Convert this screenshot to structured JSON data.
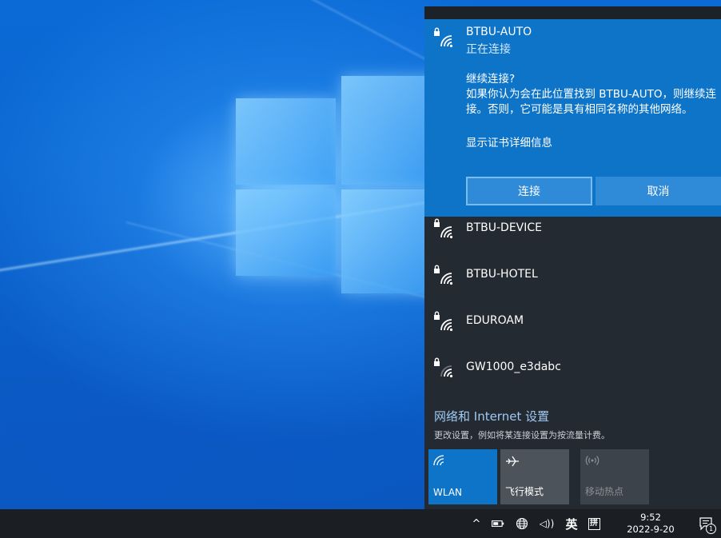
{
  "colors": {
    "accent": "#0d74c8",
    "flyout_bg": "#242a31",
    "taskbar_bg": "#1b1f24",
    "link": "#9fcaf3"
  },
  "flyout": {
    "selected": {
      "icon": "wifi-secured-icon",
      "name": "BTBU-AUTO",
      "status": "正在连接",
      "question": "继续连接?",
      "message": "如果你认为会在此位置找到 BTBU-AUTO，则继续连接。否则，它可能是具有相同名称的其他网络。",
      "cert_link": "显示证书详细信息",
      "connect_label": "连接",
      "cancel_label": "取消"
    },
    "networks": [
      {
        "name": "BTBU-DEVICE",
        "icon": "wifi-secured-icon"
      },
      {
        "name": "BTBU-HOTEL",
        "icon": "wifi-secured-icon"
      },
      {
        "name": "EDUROAM",
        "icon": "wifi-secured-icon"
      },
      {
        "name": "GW1000_e3dabc",
        "icon": "wifi-secured-weak-icon"
      }
    ],
    "settings": {
      "title": "网络和 Internet 设置",
      "desc": "更改设置，例如将某连接设置为按流量计费。"
    },
    "quick_actions": [
      {
        "label": "WLAN",
        "icon": "wifi-icon",
        "state": "on"
      },
      {
        "label": "飞行模式",
        "icon": "airplane-icon",
        "state": "off"
      },
      {
        "label": "移动热点",
        "icon": "hotspot-icon",
        "state": "disabled"
      }
    ]
  },
  "taskbar": {
    "chevron": "^",
    "volume": "◁))",
    "language": "英",
    "ime": "拼",
    "time": "9:52",
    "date": "2022-9-20",
    "notification_count": "1"
  }
}
